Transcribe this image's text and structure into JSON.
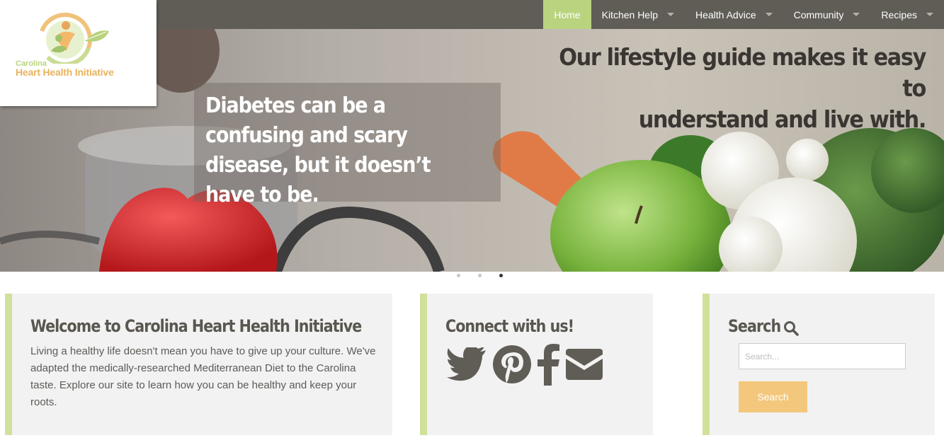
{
  "logo": {
    "line1": "Carolina",
    "line2": "Heart Health Initiative"
  },
  "nav": {
    "items": [
      {
        "label": "Home",
        "active": true,
        "dropdown": false
      },
      {
        "label": "Kitchen Help",
        "active": false,
        "dropdown": true
      },
      {
        "label": "Health Advice",
        "active": false,
        "dropdown": true
      },
      {
        "label": "Community",
        "active": false,
        "dropdown": true
      },
      {
        "label": "Recipes",
        "active": false,
        "dropdown": true
      }
    ]
  },
  "hero": {
    "headline_line1": "Our lifestyle guide makes it easy to",
    "headline_line2": "understand and live with.",
    "tagline": "Diabetes can be a confusing and scary disease, but it doesn’t have to be.",
    "slides": 3,
    "current_slide": 3
  },
  "welcome": {
    "title": "Welcome to Carolina Heart Health Initiative",
    "text": "Living a healthy life doesn't mean you have to give up your culture. We've adapted the medically-researched Mediterranean Diet to the Carolina taste. Explore our site to learn how you can be healthy and keep your roots."
  },
  "connect": {
    "title": "Connect with us!",
    "icons": [
      "twitter-icon",
      "pinterest-icon",
      "facebook-icon",
      "envelope-icon"
    ]
  },
  "search": {
    "title": "Search",
    "placeholder": "Search...",
    "button_label": "Search"
  },
  "colors": {
    "nav_bg": "#5f5d56",
    "accent_green": "#b9d37f",
    "panel_border": "#cfe19a",
    "button_orange": "#f3c77c",
    "panel_bg": "#f2f2f2"
  }
}
